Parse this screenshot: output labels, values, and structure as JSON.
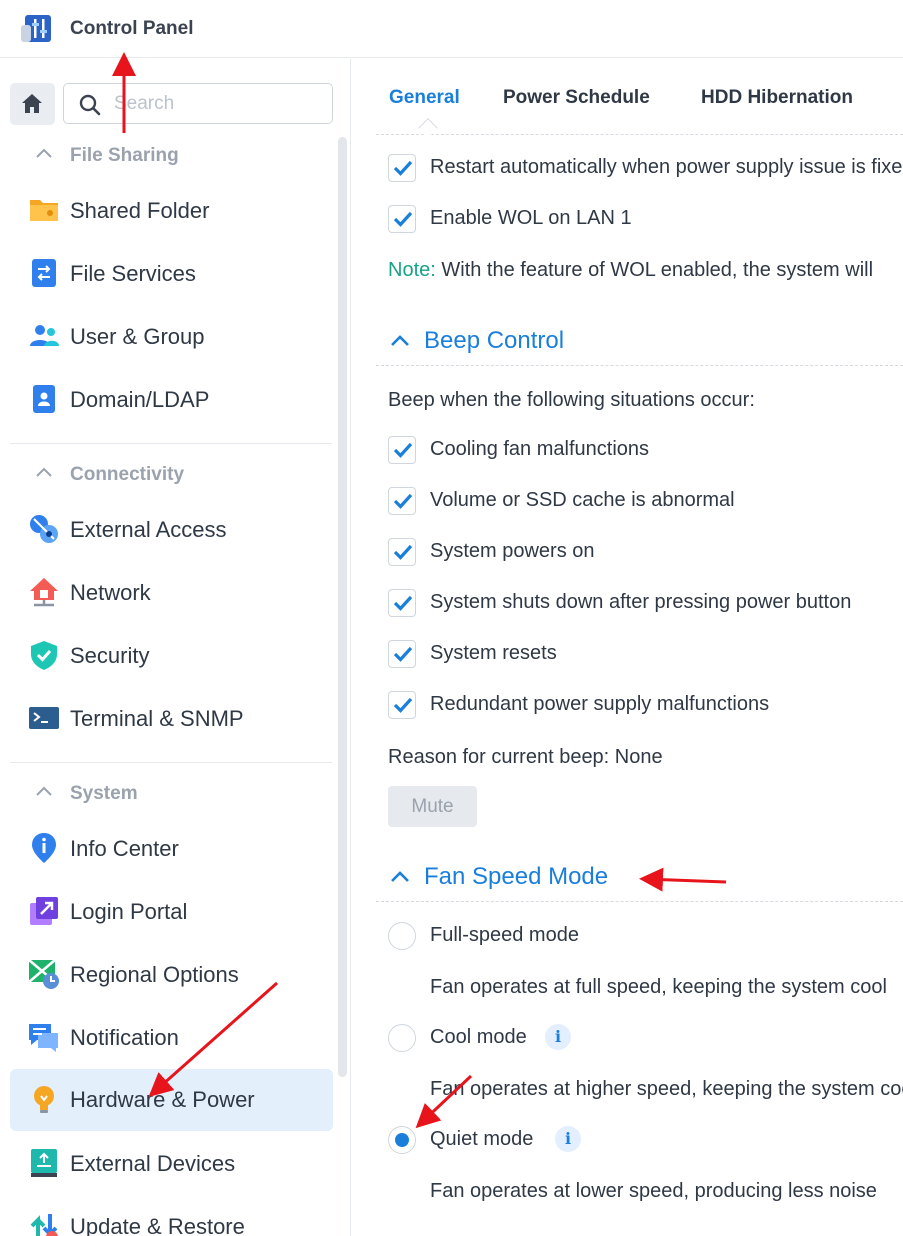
{
  "app": {
    "title": "Control Panel",
    "icon": "control-panel-icon"
  },
  "sidebar": {
    "search_placeholder": "Search",
    "groups": [
      {
        "label": "File Sharing",
        "items": [
          "Shared Folder",
          "File Services",
          "User & Group",
          "Domain/LDAP"
        ]
      },
      {
        "label": "Connectivity",
        "items": [
          "External Access",
          "Network",
          "Security",
          "Terminal & SNMP"
        ]
      },
      {
        "label": "System",
        "items": [
          "Info Center",
          "Login Portal",
          "Regional Options",
          "Notification",
          "Hardware & Power",
          "External Devices",
          "Update & Restore"
        ]
      }
    ],
    "active_item": "Hardware & Power"
  },
  "tabs": [
    "General",
    "Power Schedule",
    "HDD Hibernation"
  ],
  "active_tab": "General",
  "power": {
    "restart_auto": "Restart automatically when power supply issue is fixed",
    "wol": "Enable WOL on LAN 1",
    "note_key": "Note:",
    "note_text": "With the feature of WOL enabled, the system will"
  },
  "beep": {
    "title": "Beep Control",
    "intro": "Beep when the following situations occur:",
    "options": [
      "Cooling fan malfunctions",
      "Volume or SSD cache is abnormal",
      "System powers on",
      "System shuts down after pressing power button",
      "System resets",
      "Redundant power supply malfunctions"
    ],
    "reason": "Reason for current beep: None",
    "mute": "Mute"
  },
  "fan": {
    "title": "Fan Speed Mode",
    "modes": [
      {
        "label": "Full-speed mode",
        "desc": "Fan operates at full speed, keeping the system cool",
        "selected": false,
        "info": false
      },
      {
        "label": "Cool mode",
        "desc": "Fan operates at higher speed, keeping the system cool",
        "selected": false,
        "info": true
      },
      {
        "label": "Quiet mode",
        "desc": "Fan operates at lower speed, producing less noise",
        "selected": true,
        "info": true
      }
    ]
  },
  "colors": {
    "accent": "#1a7fdb",
    "note": "#19a28a",
    "active_bg": "#e4effc",
    "arrow": "#e8141c"
  }
}
